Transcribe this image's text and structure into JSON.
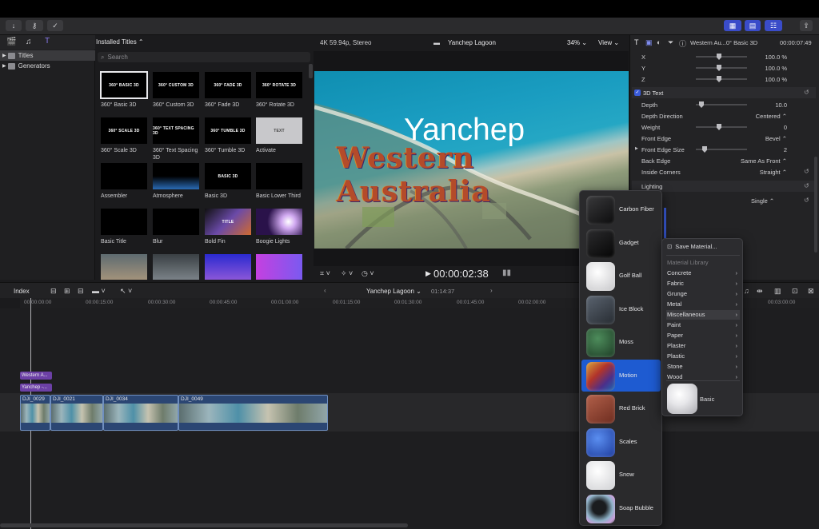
{
  "toolbar": {
    "import_icon": "download-arrow",
    "key_icon": "key",
    "check_icon": "checkmark-circle",
    "share_icon": "share"
  },
  "sidebar": {
    "items": [
      {
        "label": "Titles"
      },
      {
        "label": "Generators"
      }
    ]
  },
  "browser": {
    "header": "Installed Titles ⌃",
    "search_placeholder": "Search",
    "thumbs": [
      {
        "text": "360° BASIC 3D",
        "label": "360° Basic 3D"
      },
      {
        "text": "360° CUSTOM 3D",
        "label": "360° Custom 3D"
      },
      {
        "text": "360° FADE 3D",
        "label": "360° Fade 3D"
      },
      {
        "text": "360° ROTATE 3D",
        "label": "360° Rotate 3D"
      },
      {
        "text": "360° SCALE 3D",
        "label": "360° Scale 3D"
      },
      {
        "text": "360° TEXT SPACING 3D",
        "label": "360° Text Spacing 3D"
      },
      {
        "text": "360° TUMBLE 3D",
        "label": "360° Tumble 3D"
      },
      {
        "text": "TEXT",
        "label": "Activate"
      },
      {
        "text": "",
        "label": "Assembler"
      },
      {
        "text": "",
        "label": "Atmosphere"
      },
      {
        "text": "BASIC 3D",
        "label": "Basic 3D"
      },
      {
        "text": "",
        "label": "Basic Lower Third"
      },
      {
        "text": "",
        "label": "Basic Title"
      },
      {
        "text": "",
        "label": "Blur"
      },
      {
        "text": "TITLE",
        "label": "Bold Fin"
      },
      {
        "text": "",
        "label": "Boogie Lights"
      }
    ]
  },
  "viewer": {
    "format": "4K 59.94p, Stereo",
    "project": "Yanchep Lagoon",
    "zoom": "34% ⌄",
    "view": "View ⌄",
    "title_line1": "Yanchep",
    "title_line2": "Western Australia",
    "timecode": "00:00:02:38",
    "play_icon": "play"
  },
  "inspector": {
    "clip_name": "Western Au...0° Basic 3D",
    "duration": "00:00:07:49",
    "rows": [
      {
        "label": "X",
        "value": "100.0  %"
      },
      {
        "label": "Y",
        "value": "100.0  %"
      },
      {
        "label": "Z",
        "value": "100.0  %"
      }
    ],
    "section_3d": "3D Text",
    "props": [
      {
        "label": "Depth",
        "value": "10.0"
      },
      {
        "label": "Depth Direction",
        "value": "Centered ⌃"
      },
      {
        "label": "Weight",
        "value": "0"
      },
      {
        "label": "Front Edge",
        "value": "Bevel ⌃"
      },
      {
        "label": "Front Edge Size",
        "value": "2"
      },
      {
        "label": "Back Edge",
        "value": "Same As Front ⌃"
      },
      {
        "label": "Inside Corners",
        "value": "Straight ⌃"
      }
    ],
    "lighting": "Lighting",
    "single": "Single ⌃"
  },
  "timeline": {
    "index": "Index",
    "project": "Yanchep Lagoon ⌄",
    "duration": "01:14:37",
    "ruler": [
      "00:00:00:00",
      "00:00:15:00",
      "00:00:30:00",
      "00:00:45:00",
      "00:01:00:00",
      "00:01:15:00",
      "00:01:30:00",
      "00:01:45:00",
      "00:02:00:00",
      "00:03:00:00"
    ],
    "title_clips": [
      "Western A...",
      "Yanchep -..."
    ],
    "video_clips": [
      "DJI_0029",
      "DJI_0021",
      "DJI_0034",
      "DJI_0049"
    ]
  },
  "materials": {
    "items": [
      {
        "label": "Carbon Fiber",
        "color": "#1a1a1b"
      },
      {
        "label": "Gadget",
        "color": "#0e0e0f"
      },
      {
        "label": "Golf Ball",
        "color": "#d9d9db"
      },
      {
        "label": "Ice Block",
        "color": "#3a4149"
      },
      {
        "label": "Moss",
        "color": "#2d5a3a"
      },
      {
        "label": "Motion",
        "color": "#b0502a"
      },
      {
        "label": "Red Brick",
        "color": "#8b4432"
      },
      {
        "label": "Scales",
        "color": "#2f5fc0"
      },
      {
        "label": "Snow",
        "color": "#e4e4e6"
      },
      {
        "label": "Soap Bubble",
        "color": "#44494d"
      }
    ],
    "selected": "Motion"
  },
  "menu": {
    "save": "Save Material...",
    "library_header": "Material Library",
    "items": [
      "Concrete",
      "Fabric",
      "Grunge",
      "Metal",
      "Miscellaneous",
      "Paint",
      "Paper",
      "Plaster",
      "Plastic",
      "Stone",
      "Wood"
    ],
    "highlighted": "Miscellaneous",
    "basic": "Basic"
  }
}
